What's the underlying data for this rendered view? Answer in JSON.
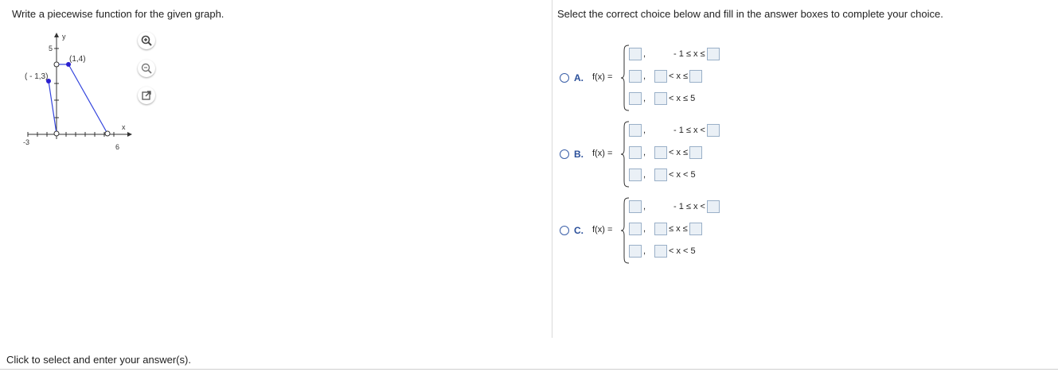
{
  "left": {
    "instruction": "Write a piecewise function for the given graph.",
    "footer": "Click to select and enter your answer(s).",
    "graph": {
      "y_axis_label": "y",
      "x_axis_label": "x",
      "y_tick_label": "5",
      "x_tick_left": "-3",
      "x_tick_right": "6",
      "point_a_label": "(1,4)",
      "point_b_label": "( - 1,3)"
    },
    "tools": [
      "zoom-in-icon",
      "zoom-out-icon",
      "expand-icon"
    ]
  },
  "right": {
    "instruction": "Select the correct choice below and fill in the answer boxes to complete your choice.",
    "choices": [
      {
        "letter": "A.",
        "fx": "f(x) =",
        "rows": [
          {
            "cond": "- 1 ≤ x ≤",
            "lead_box": false,
            "tail_box": true
          },
          {
            "cond": "< x ≤",
            "lead_box": true,
            "tail_box": true
          },
          {
            "cond": "< x ≤ 5",
            "lead_box": true,
            "tail_box": false
          }
        ]
      },
      {
        "letter": "B.",
        "fx": "f(x) =",
        "rows": [
          {
            "cond": "- 1 ≤ x <",
            "lead_box": false,
            "tail_box": true
          },
          {
            "cond": "< x ≤",
            "lead_box": true,
            "tail_box": true
          },
          {
            "cond": "< x < 5",
            "lead_box": true,
            "tail_box": false
          }
        ]
      },
      {
        "letter": "C.",
        "fx": "f(x) =",
        "rows": [
          {
            "cond": "- 1 ≤ x <",
            "lead_box": false,
            "tail_box": true
          },
          {
            "cond": "≤ x ≤",
            "lead_box": true,
            "tail_box": true
          },
          {
            "cond": "< x < 5",
            "lead_box": true,
            "tail_box": false
          }
        ]
      }
    ]
  },
  "colors": {
    "line": "#3344dd",
    "dot": "#2b1fcf",
    "choice": "#2a4f9a",
    "box_fill": "#eaf0f6",
    "box_border": "#9ab0c8"
  }
}
